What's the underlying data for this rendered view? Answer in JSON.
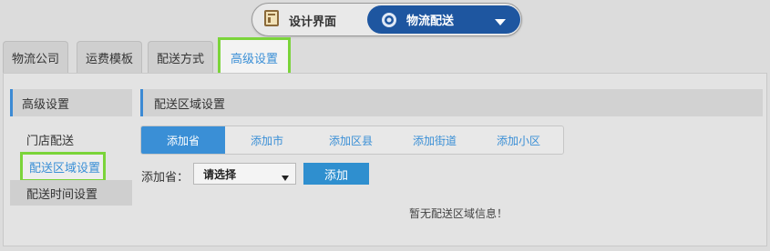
{
  "switcher": {
    "design_label": "设计界面",
    "logistics_label": "物流配送",
    "design_icon": "design-book-icon",
    "logistics_icon": "gear-icon",
    "accent_color": "#1e56a0"
  },
  "tabs": [
    {
      "label": "物流公司",
      "active": false
    },
    {
      "label": "运费模板",
      "active": false
    },
    {
      "label": "配送方式",
      "active": false
    },
    {
      "label": "高级设置",
      "active": true
    }
  ],
  "sidebar": {
    "title": "高级设置",
    "items": [
      {
        "label": "门店配送",
        "active": false
      },
      {
        "label": "配送区域设置",
        "active": true
      },
      {
        "label": "配送时间设置",
        "active": false
      }
    ]
  },
  "main": {
    "title": "配送区域设置",
    "subtabs": [
      {
        "label": "添加省",
        "active": true
      },
      {
        "label": "添加市",
        "active": false
      },
      {
        "label": "添加区县",
        "active": false
      },
      {
        "label": "添加街道",
        "active": false
      },
      {
        "label": "添加小区",
        "active": false
      }
    ],
    "form": {
      "label": "添加省：",
      "select_value": "请选择",
      "add_button": "添加"
    },
    "empty_message": "暂无配送区域信息！"
  },
  "colors": {
    "highlight_border": "#7bd43a",
    "link_blue": "#3a8fd6"
  }
}
